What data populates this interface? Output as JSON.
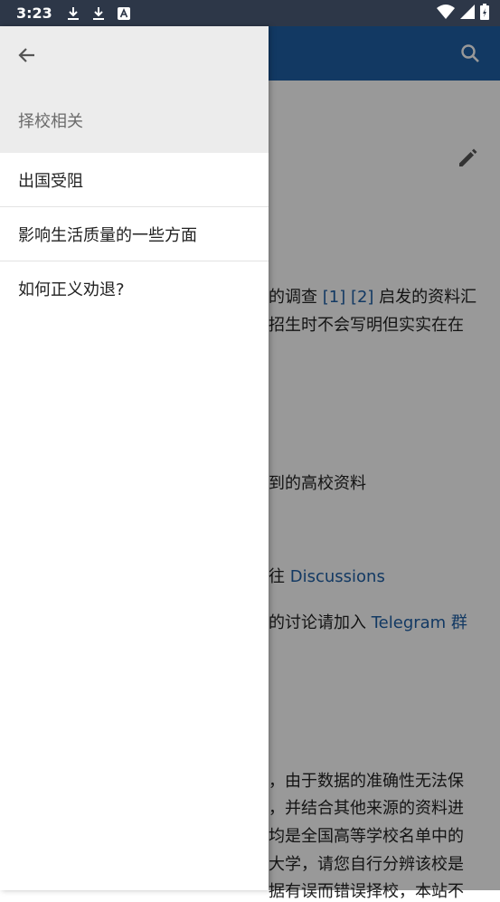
{
  "status_bar": {
    "time": "3:23",
    "icons_left": [
      "download-icon",
      "download-icon",
      "font-icon"
    ],
    "icons_right": [
      "wifi-icon",
      "signal-icon",
      "battery-icon"
    ]
  },
  "app_bar": {
    "icon": "search-icon",
    "color": "#1f5fa6"
  },
  "content": {
    "lines": [
      {
        "text": "的调查 ",
        "link": "[1] [2]",
        "after": " 启发的资料汇"
      },
      {
        "text": "招生时不会写明但实实在在",
        "link": "",
        "after": ""
      },
      {
        "text": "到的高校资料",
        "link": "",
        "after": ""
      },
      {
        "text": "往 ",
        "link": "Discussions",
        "after": ""
      },
      {
        "text": "的讨论请加入 ",
        "link": "Telegram 群",
        "after": ""
      },
      {
        "text": "，由于数据的准确性无法保",
        "link": "",
        "after": ""
      },
      {
        "text": "，并结合其他来源的资料进",
        "link": "",
        "after": ""
      },
      {
        "text": "均是全国高等学校名单中的",
        "link": "",
        "after": ""
      },
      {
        "text": "大学，请您自行分辨该校是",
        "link": "",
        "after": ""
      },
      {
        "text": "据有误而错误择校，本站不",
        "link": "",
        "after": ""
      }
    ]
  },
  "drawer": {
    "section_title": "择校相关",
    "items": [
      {
        "label": "出国受阻"
      },
      {
        "label": "影响生活质量的一些方面"
      },
      {
        "label": "如何正义劝退?"
      }
    ]
  }
}
